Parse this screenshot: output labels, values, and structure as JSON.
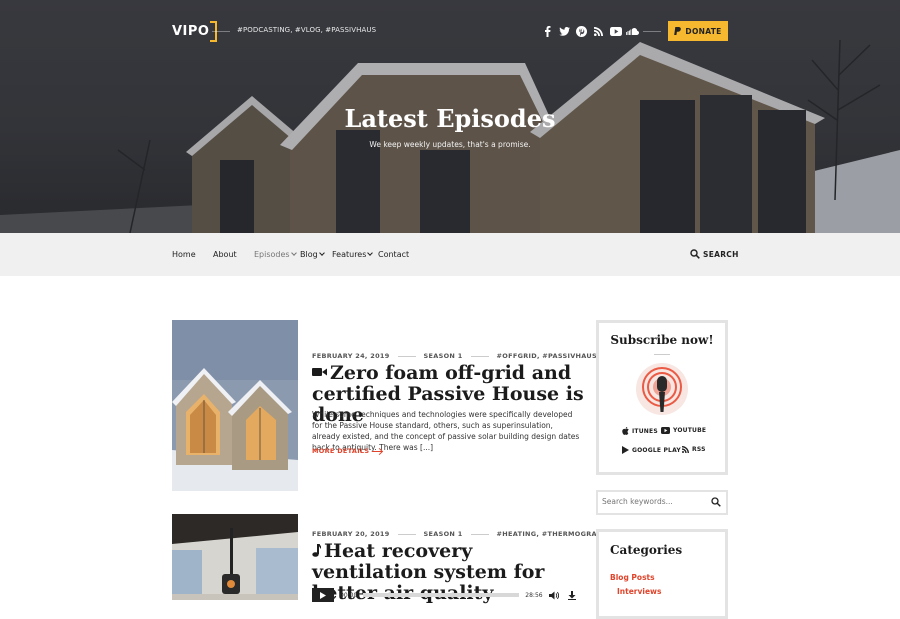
{
  "header": {
    "logo_text": "VIPO",
    "tagline": "#PODCASTING, #VLOG, #PASSIVHAUS",
    "social_icons": [
      "facebook-icon",
      "twitter-icon",
      "pinterest-icon",
      "rss-icon",
      "youtube-icon",
      "soundcloud-icon"
    ],
    "donate_label": "DONATE",
    "accent": "#f5b82e"
  },
  "hero": {
    "title": "Latest Episodes",
    "subtitle": "We keep weekly updates, that's a promise."
  },
  "nav": {
    "items": [
      {
        "label": "Home"
      },
      {
        "label": "About"
      },
      {
        "label": "Episodes"
      },
      {
        "label": "Blog"
      },
      {
        "label": "Features"
      },
      {
        "label": "Contact"
      }
    ],
    "search_label": "SEARCH"
  },
  "posts": [
    {
      "date": "FEBRUARY 24, 2019",
      "season": "SEASON 1",
      "tags": "#OFFGRID, #PASSIVHAUS",
      "icon": "video-camera-icon",
      "title": "Zero foam off-grid and certified Passive House is done",
      "excerpt": "While some techniques and technologies were specifically developed for the Passive House standard, others, such as superinsulation, already existed, and the concept of passive solar building design dates back to antiquity. There was [...]",
      "more_label": "MORE DETAILS"
    },
    {
      "date": "FEBRUARY 20, 2019",
      "season": "SEASON 1",
      "tags": "#HEATING, #THERMOGRAM",
      "icon": "music-note-icon",
      "title": "Heat recovery ventilation system for better air quality",
      "player": {
        "current": "00:00",
        "duration": "28:56",
        "progress": 0
      }
    }
  ],
  "sidebar": {
    "subscribe": {
      "title": "Subscribe now!",
      "links": [
        {
          "label": "ITUNES",
          "icon": "apple-icon"
        },
        {
          "label": "YOUTUBE",
          "icon": "youtube-icon"
        },
        {
          "label": "GOOGLE PLAY",
          "icon": "google-play-icon"
        },
        {
          "label": "RSS",
          "icon": "rss-icon"
        }
      ]
    },
    "search": {
      "placeholder": "Search keywords..."
    },
    "categories": {
      "title": "Categories",
      "items": [
        {
          "label": "Blog Posts"
        },
        {
          "label": "Interviews"
        }
      ]
    }
  },
  "colors": {
    "link": "#e0442b",
    "nav_bg": "#f0f0f0"
  }
}
